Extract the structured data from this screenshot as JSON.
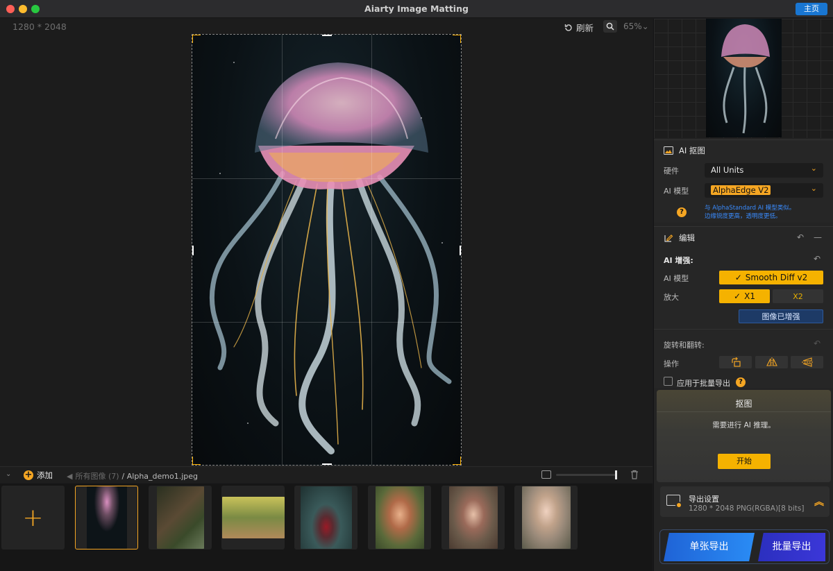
{
  "window": {
    "title": "Aiarty Image Matting",
    "home_label": "主页"
  },
  "canvas": {
    "dimensions": "1280 * 2048",
    "refresh_label": "刷新",
    "zoom": "65%"
  },
  "strip": {
    "add_label": "添加",
    "all_images": "所有图像 (7)",
    "file_name": "/ Alpha_demo1.jpeg",
    "thumbnails": [
      {
        "name": "jellyfish",
        "color": "#0d1418"
      },
      {
        "name": "forest-log",
        "color": "#5a4a34"
      },
      {
        "name": "bicycle",
        "color": "#7a8a44"
      },
      {
        "name": "red-dress-woman",
        "color": "#3a5a5a"
      },
      {
        "name": "woman-flowers-1",
        "color": "#8a5a3a"
      },
      {
        "name": "woman-flowers-2",
        "color": "#7a5a4a"
      },
      {
        "name": "woman-flowers-3",
        "color": "#9a8a7a"
      }
    ]
  },
  "ai_matte": {
    "title": "AI 抠图",
    "hardware_label": "硬件",
    "hardware_value": "All Units",
    "model_label": "AI 模型",
    "model_value": "AlphaEdge  V2",
    "hint_line1": "与 AlphaStandard AI 模型类似。",
    "hint_line2": "边缘锐度更高，透明度更低。"
  },
  "edit": {
    "title": "编辑",
    "enhance_label": "AI 增强:",
    "ai_model_label": "AI 模型",
    "ai_model_value": "Smooth Diff v2",
    "upscale_label": "放大",
    "upscale_x1": "X1",
    "upscale_x2": "X2",
    "enhanced_button": "图像已增强",
    "rotate_label": "旋转和翻转:",
    "operation_label": "操作",
    "batch_apply_label": "应用于批量导出"
  },
  "matte_panel": {
    "title": "抠图",
    "message": "需要进行 AI 推理。",
    "start_label": "开始"
  },
  "export": {
    "settings_title": "导出设置",
    "settings_detail": "1280 * 2048 PNG(RGBA)[8 bits]",
    "single_label": "单张导出",
    "batch_label": "批量导出"
  },
  "colors": {
    "accent": "#f5a623",
    "home_blue": "#1976d2",
    "single_export_blue": "#2a8cf5",
    "batch_export_indigo": "#3b37d8"
  }
}
